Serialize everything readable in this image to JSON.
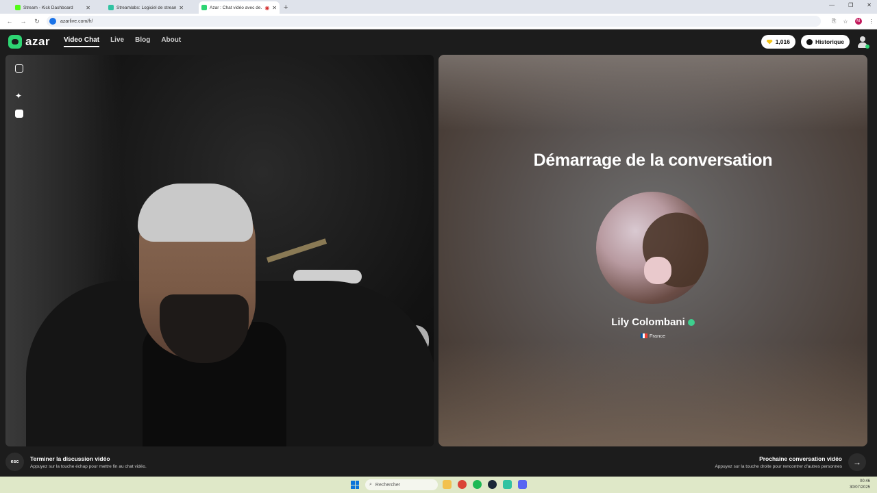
{
  "browser": {
    "tabs": [
      {
        "title": "Stream - Kick Dashboard",
        "color": "#53fc18",
        "active": false
      },
      {
        "title": "Streamlabs: Logiciel de stream…",
        "color": "#31c3a2",
        "active": false
      },
      {
        "title": "Azar : Chat vidéo avec de…",
        "color": "#2ed573",
        "active": true
      }
    ],
    "new_tab": "+",
    "url": "azarlive.com/fr/"
  },
  "nav": {
    "logo": "azar",
    "menu": [
      {
        "label": "Video Chat",
        "active": true
      },
      {
        "label": "Live",
        "active": false
      },
      {
        "label": "Blog",
        "active": false
      },
      {
        "label": "About",
        "active": false
      }
    ],
    "gems": "1,016",
    "history": "Historique"
  },
  "match": {
    "title": "Démarrage de la conversation",
    "name": "Lily Colombani",
    "country": "France"
  },
  "controls": {
    "esc_key": "esc",
    "end_title": "Terminer la discussion vidéo",
    "end_hint": "Appuyez sur la touche échap pour mettre fin au chat vidéo.",
    "next_title": "Prochaine conversation vidéo",
    "next_hint": "Appuyez sur la touche droite pour rencontrer d'autres personnes",
    "arrow": "→"
  },
  "taskbar": {
    "search_placeholder": "Rechercher",
    "time": "00:46",
    "date": "30/07/2025"
  },
  "colors": {
    "accent": "#2ed573",
    "gem": "#f5c518"
  }
}
